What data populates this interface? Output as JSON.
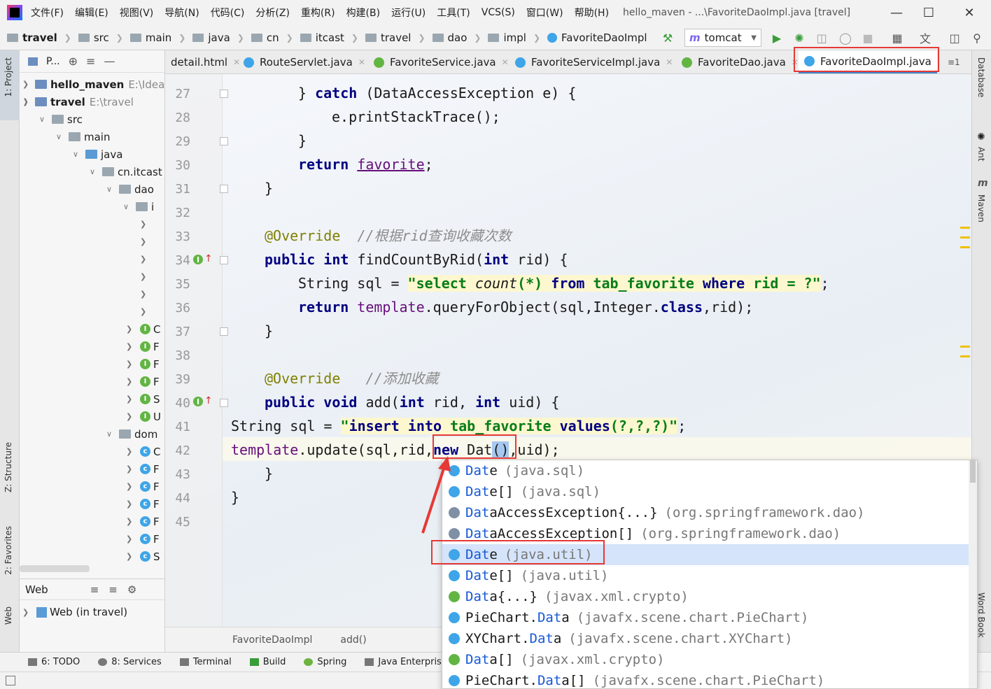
{
  "menu": [
    "文件(F)",
    "编辑(E)",
    "视图(V)",
    "导航(N)",
    "代码(C)",
    "分析(Z)",
    "重构(R)",
    "构建(B)",
    "运行(U)",
    "工具(T)",
    "VCS(S)",
    "窗口(W)",
    "帮助(H)"
  ],
  "window_title": "hello_maven - ...\\FavoriteDaoImpl.java [travel]",
  "breadcrumbs": [
    "travel",
    "src",
    "main",
    "java",
    "cn",
    "itcast",
    "travel",
    "dao",
    "impl",
    "FavoriteDaoImpl"
  ],
  "run_config": "tomcat",
  "left_tabs": {
    "project": "1: Project",
    "structure": "Z: Structure",
    "favorites": "2: Favorites",
    "web": "Web"
  },
  "right_tabs": {
    "database": "Database",
    "ant": "Ant",
    "maven": "Maven",
    "wordbook": "Word Book"
  },
  "project_header": "P...",
  "tree": [
    {
      "label": "hello_maven",
      "hint": "E:\\IdeaP"
    },
    {
      "label": "travel",
      "hint": "E:\\travel"
    },
    {
      "label": "src"
    },
    {
      "label": "main"
    },
    {
      "label": "java"
    },
    {
      "label": "cn.itcast"
    },
    {
      "label": "dao"
    },
    {
      "label": "i"
    },
    {
      "label": "dom"
    }
  ],
  "tree_items_letters": [
    "C",
    "F",
    "F",
    "F",
    "S",
    "U"
  ],
  "tree_domain_letters": [
    "C",
    "F",
    "F",
    "F",
    "F",
    "F",
    "S"
  ],
  "web_panel": {
    "title": "Web",
    "item": "Web (in travel)"
  },
  "tabs": [
    "detail.html",
    "RouteServlet.java",
    "FavoriteService.java",
    "FavoriteServiceImpl.java",
    "FavoriteDao.java",
    "FavoriteDaoImpl.java"
  ],
  "tab_overflow": "≡1",
  "line_numbers": [
    "27",
    "28",
    "29",
    "30",
    "31",
    "32",
    "33",
    "34",
    "35",
    "36",
    "37",
    "38",
    "39",
    "40",
    "41",
    "42",
    "43",
    "44",
    "45"
  ],
  "code": {
    "l27_a": "} ",
    "l27_kw": "catch",
    "l27_b": " (DataAccessException e) {",
    "l28": "e.printStackTrace();",
    "l29": "}",
    "l30_kw": "return",
    "l30_b": " ",
    "l30_fld": "favorite",
    "l30_c": ";",
    "l31": "}",
    "l33_ann": "@Override",
    "l33_cm": "//根据rid查询收藏次数",
    "l34_kw1": "public",
    "l34_kw2": "int",
    "l34_a": " findCountByRid(",
    "l34_kw3": "int",
    "l34_b": " rid) {",
    "l35_a": "String sql = ",
    "l35_s1": "\"select ",
    "l35_fn": "count",
    "l35_s2": "(*) ",
    "l35_kwa": "from",
    "l35_s3": " tab_favorite ",
    "l35_kwb": "where",
    "l35_s4": " rid = ?\"",
    "l35_b": ";",
    "l36_kw": "return",
    "l36_fld": "template",
    "l36_a": ".queryForObject(sql,Integer.",
    "l36_kw2": "class",
    "l36_b": ",rid);",
    "l37": "}",
    "l39_ann": "@Override",
    "l39_cm": "//添加收藏",
    "l40_kw1": "public",
    "l40_kw2": "void",
    "l40_a": " add(",
    "l40_kw3": "int",
    "l40_b": " rid, ",
    "l40_kw4": "int",
    "l40_c": " uid) {",
    "l41_a": "String sql = ",
    "l41_s1": "\"",
    "l41_kwa": "insert",
    "l41_s2": " ",
    "l41_kwb": "into",
    "l41_s3": " tab_favorite ",
    "l41_kwc": "values",
    "l41_s4": "(?,?,?)\"",
    "l41_b": ";",
    "l42_fld": "template",
    "l42_a": ".update(sql,rid,",
    "l42_kw": "new",
    "l42_b": " Dat",
    "l42_c": "()",
    "l42_d": ",uid);",
    "l43": "}",
    "l44": "}"
  },
  "bottom_crumb": [
    "FavoriteDaoImpl",
    "add()"
  ],
  "completion": [
    {
      "match": "Dat",
      "rest": "e",
      "pkg": "(java.sql)",
      "icon": "class"
    },
    {
      "match": "Dat",
      "rest": "e[]",
      "pkg": "(java.sql)",
      "icon": "class"
    },
    {
      "match": "Dat",
      "rest": "aAccessException{...}",
      "pkg": "(org.springframework.dao)",
      "icon": "exception"
    },
    {
      "match": "Dat",
      "rest": "aAccessException[]",
      "pkg": "(org.springframework.dao)",
      "icon": "exception"
    },
    {
      "match": "Dat",
      "rest": "e",
      "pkg": "(java.util)",
      "icon": "class"
    },
    {
      "match": "Dat",
      "rest": "e[]",
      "pkg": "(java.util)",
      "icon": "class"
    },
    {
      "match": "Dat",
      "rest": "a{...}",
      "pkg": "(javax.xml.crypto)",
      "icon": "interface"
    },
    {
      "prefix": "PieChart.",
      "match": "Dat",
      "rest": "a",
      "pkg": "(javafx.scene.chart.PieChart)",
      "icon": "class"
    },
    {
      "prefix": "XYChart.",
      "match": "Dat",
      "rest": "a",
      "pkg": "(javafx.scene.chart.XYChart)",
      "icon": "class"
    },
    {
      "match": "Dat",
      "rest": "a[]",
      "pkg": "(javax.xml.crypto)",
      "icon": "interface"
    },
    {
      "prefix": "PieChart.",
      "match": "Dat",
      "rest": "a[]",
      "pkg": "(javafx.scene.chart.PieChart)",
      "icon": "class"
    }
  ],
  "bottom_tools": [
    {
      "label": "6: TODO"
    },
    {
      "label": "8: Services"
    },
    {
      "label": "Terminal"
    },
    {
      "label": "Build"
    },
    {
      "label": "Spring"
    },
    {
      "label": "Java Enterprise"
    }
  ],
  "colors": {
    "accent": "#4083c9",
    "highlight": "#e53935",
    "selection": "#d5e4fa"
  }
}
